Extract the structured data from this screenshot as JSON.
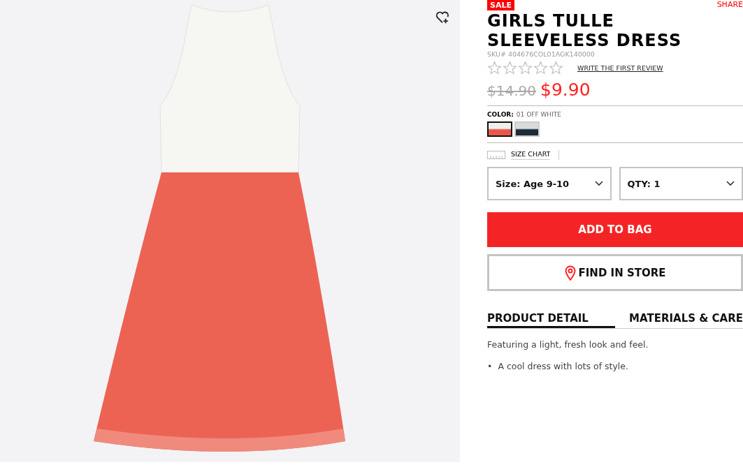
{
  "product_image": {
    "wishlist": true
  },
  "badge": "SALE",
  "share": "SHARE",
  "title": "GIRLS TULLE SLEEVELESS DRESS",
  "sku": "SKU# 404676COL01AGK140000",
  "rating": {
    "stars": 0,
    "review_link": "WRITE THE FIRST REVIEW"
  },
  "price": {
    "original": "$14.90",
    "sale": "$9.90"
  },
  "color": {
    "label": "COLOR:",
    "value": "01 OFF WHITE",
    "swatches": [
      {
        "kind": "white-coral",
        "selected": true
      },
      {
        "kind": "navy",
        "selected": false
      }
    ]
  },
  "size_chart": "SIZE CHART",
  "selects": [
    {
      "label": "Size: Age 9-10"
    },
    {
      "label": "QTY: 1"
    }
  ],
  "buttons": {
    "add_to_bag": "ADD TO BAG",
    "find_in_store": "FIND IN STORE"
  },
  "tabs": [
    {
      "label": "PRODUCT DETAIL",
      "selected": true
    },
    {
      "label": "MATERIALS & CARE",
      "selected": false
    }
  ],
  "detail": {
    "text": "Featuring a light, fresh look and feel.",
    "bullets": [
      {
        "marker": "•",
        "text": "A cool dress with lots of style."
      }
    ]
  }
}
